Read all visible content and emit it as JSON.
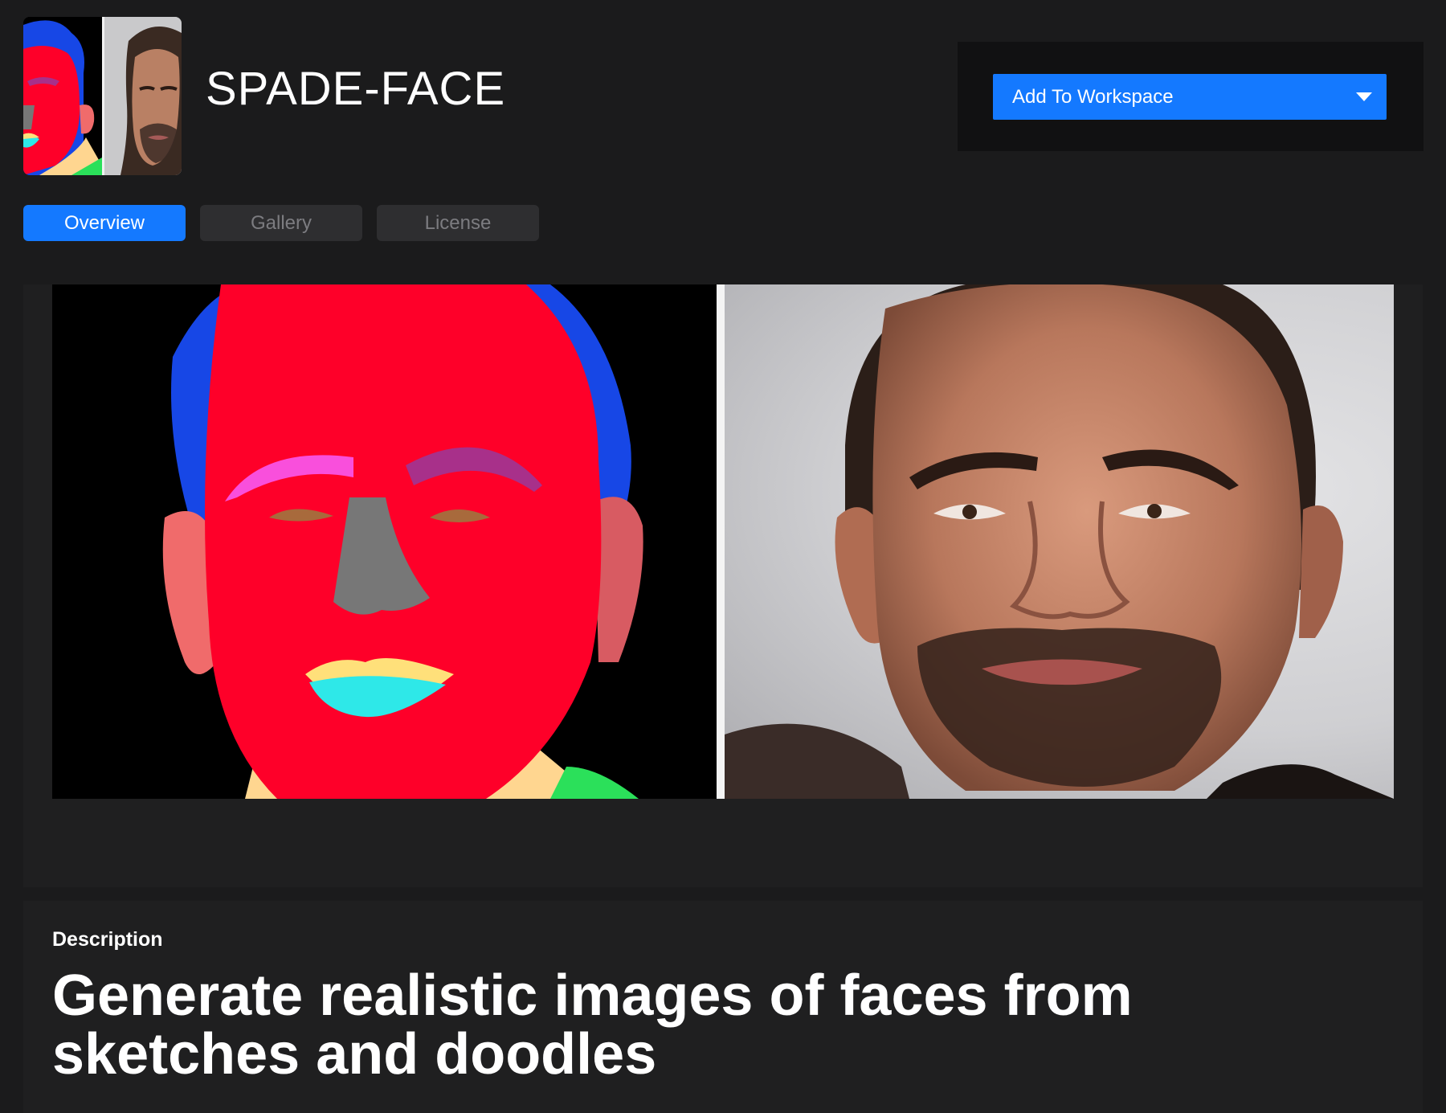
{
  "app": {
    "title": "SPADE-FACE"
  },
  "actions": {
    "add_to_workspace_label": "Add To Workspace"
  },
  "tabs": [
    {
      "label": "Overview",
      "active": true
    },
    {
      "label": "Gallery",
      "active": false
    },
    {
      "label": "License",
      "active": false
    }
  ],
  "description": {
    "label": "Description",
    "heading": "Generate realistic images of faces from sketches and doodles"
  },
  "colors": {
    "accent": "#1479ff",
    "background": "#1b1b1c",
    "panel": "#1f1f20",
    "tab_inactive": "#2e2e30"
  },
  "icons": {
    "dropdown": "chevron-down-icon"
  }
}
